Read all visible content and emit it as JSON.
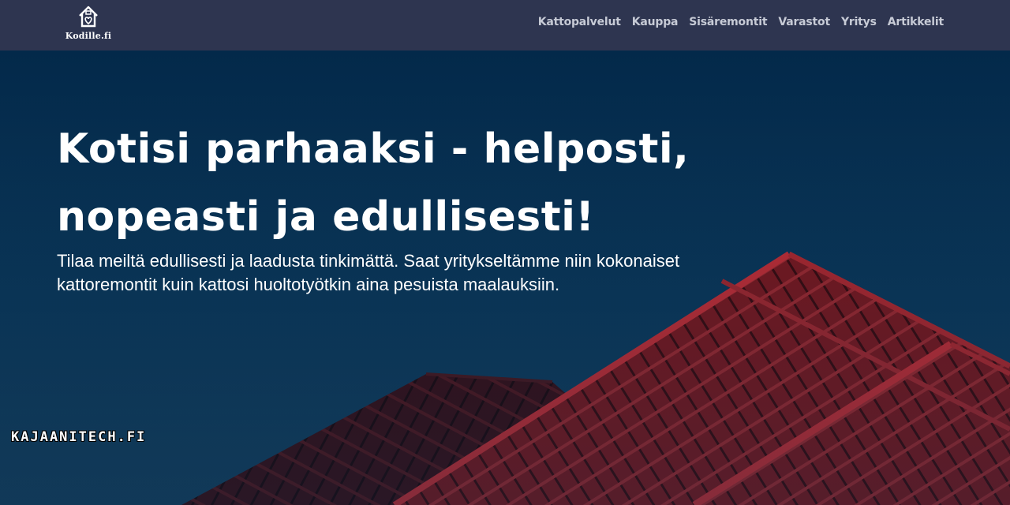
{
  "header": {
    "logo_text": "Kodille.fi",
    "nav": [
      {
        "label": "Kattopalvelut"
      },
      {
        "label": "Kauppa"
      },
      {
        "label": "Sisäremontit"
      },
      {
        "label": "Varastot"
      },
      {
        "label": "Yritys"
      },
      {
        "label": "Artikkelit"
      }
    ]
  },
  "hero": {
    "headline_line1": "Kotisi parhaaksi - helposti,",
    "headline_line2": "nopeasti ja edullisesti!",
    "subtext_line1": "Tilaa meiltä edullisesti ja laadusta tinkimättä. Saat yritykseltämme niin kokonaiset",
    "subtext_line2": "kattoremontit kuin kattosi huoltotyötkin aina pesuista maalauksiin."
  },
  "watermark": "KAJAANITECH.FI",
  "colors": {
    "navbar": "#2e3550",
    "sky": "#0a3658",
    "roof": "#8e1a1e",
    "text": "#ffffff"
  }
}
